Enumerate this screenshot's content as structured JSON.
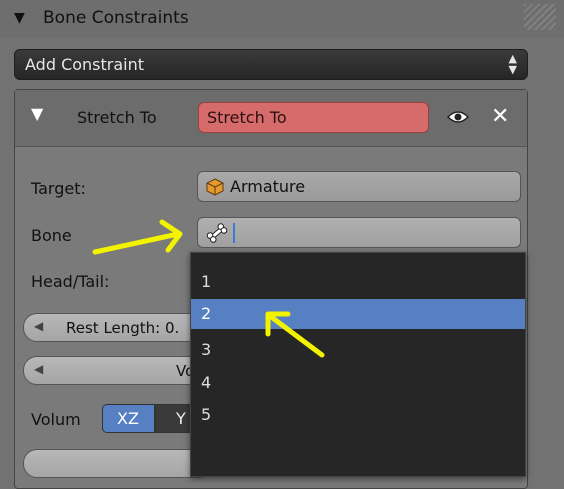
{
  "panel": {
    "title": "Bone Constraints"
  },
  "add_constraint": {
    "label": "Add Constraint"
  },
  "constraint": {
    "type_label": "Stretch To",
    "name_value": "Stretch To",
    "name_color": "#d66b6b"
  },
  "fields": {
    "target_label": "Target:",
    "target_value": "Armature",
    "bone_label": "Bone",
    "bone_value": "",
    "headtail_label": "Head/Tail:",
    "rest_length_label": "Rest Length: 0.",
    "volume_partial": "Vo",
    "volume_label": "Volum",
    "volume_options": [
      "XZ",
      "Y"
    ],
    "volume_selected": "XZ"
  },
  "dropdown": {
    "options": [
      "1",
      "2",
      "3",
      "4",
      "5"
    ],
    "selected_index": 1,
    "highlight_color": "#5680c2"
  },
  "annotations": {
    "arrow_color": "#f3f300"
  }
}
